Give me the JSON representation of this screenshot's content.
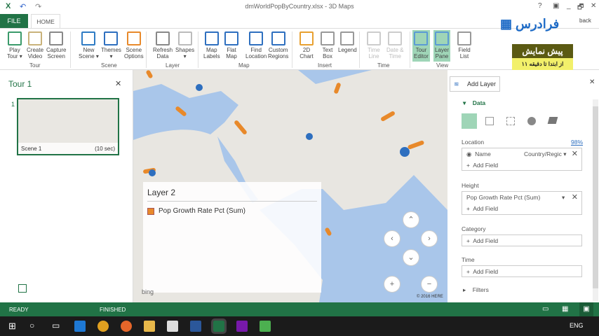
{
  "window": {
    "title": "dmWorldPopByCountry.xlsx - 3D Maps",
    "help": "?",
    "min": "_",
    "restore": "🗗",
    "close": "✕"
  },
  "ribbon": {
    "tabs": [
      "FILE",
      "HOME"
    ],
    "groups": [
      "Tour",
      "Scene",
      "Layer",
      "Map",
      "Insert",
      "Time",
      "View"
    ],
    "buttons": [
      {
        "l1": "Play",
        "l2": "Tour ▾"
      },
      {
        "l1": "Create",
        "l2": "Video"
      },
      {
        "l1": "Capture",
        "l2": "Screen"
      },
      {
        "l1": "New",
        "l2": "Scene ▾"
      },
      {
        "l1": "Themes",
        "l2": "▾"
      },
      {
        "l1": "Scene",
        "l2": "Options"
      },
      {
        "l1": "Refresh",
        "l2": "Data"
      },
      {
        "l1": "Shapes",
        "l2": "▾"
      },
      {
        "l1": "Map",
        "l2": "Labels"
      },
      {
        "l1": "Flat",
        "l2": "Map"
      },
      {
        "l1": "Find",
        "l2": "Location"
      },
      {
        "l1": "Custom",
        "l2": "Regions"
      },
      {
        "l1": "2D",
        "l2": "Chart"
      },
      {
        "l1": "Text",
        "l2": "Box"
      },
      {
        "l1": "Legend",
        "l2": ""
      },
      {
        "l1": "Time",
        "l2": "Line"
      },
      {
        "l1": "Date &",
        "l2": "Time"
      },
      {
        "l1": "Tour",
        "l2": "Editor"
      },
      {
        "l1": "Layer",
        "l2": "Pane"
      },
      {
        "l1": "Field",
        "l2": "List"
      }
    ],
    "feedback": "back"
  },
  "promo": {
    "logo": "فرادرس",
    "title": "پیش نمایش",
    "subtitle": "از ابتدا تا دقیقه ۱۱"
  },
  "tour": {
    "title": "Tour 1",
    "close": "✕",
    "scene_number": "1",
    "scene_name": "Scene 1",
    "scene_duration": "(10 sec)"
  },
  "map": {
    "legend_title": "Layer 2",
    "legend_item": "Pop Growth Rate Pct (Sum)",
    "copyright": "© 2016 HERE",
    "bing": "bing",
    "accent": "#e8892a"
  },
  "layer_pane": {
    "add_layer": "Add Layer",
    "close": "✕",
    "section": "Data",
    "location_label": "Location",
    "location_pct": "98%",
    "location_field": "Name",
    "location_type": "Country/Regic",
    "add_field": "Add Field",
    "height_label": "Height",
    "height_field": "Pop Growth Rate Pct (Sum)",
    "category_label": "Category",
    "time_label": "Time",
    "filters": "Filters"
  },
  "status": {
    "ready": "READY",
    "finished": "FINISHED"
  },
  "taskbar": {
    "lang": "ENG"
  }
}
